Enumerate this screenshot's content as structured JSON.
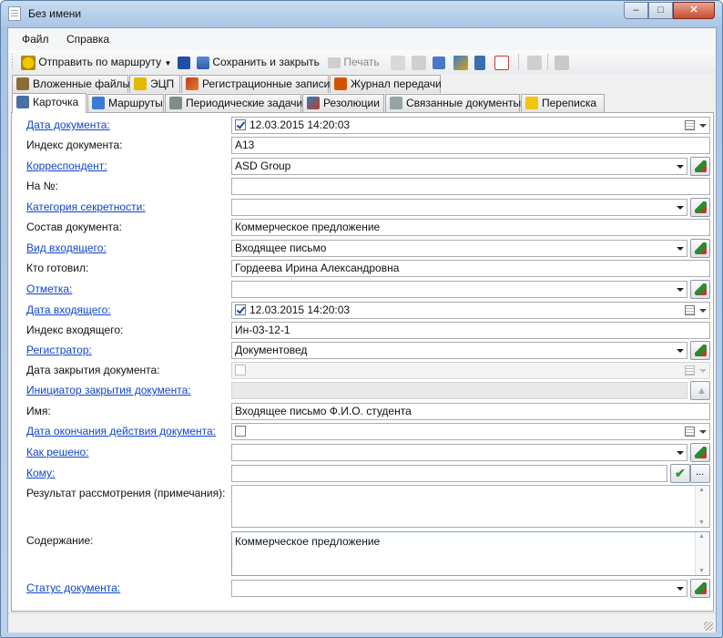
{
  "window": {
    "title": "Без имени",
    "min": "–",
    "max": "□",
    "close": "✕"
  },
  "menu": [
    {
      "label": "Файл"
    },
    {
      "label": "Справка"
    }
  ],
  "toolbar": {
    "route": "Отправить по маршруту",
    "save_close": "Сохранить и закрыть",
    "print": "Печать"
  },
  "tabs_row1": [
    {
      "label": "Вложенные файлы"
    },
    {
      "label": "ЭЦП"
    },
    {
      "label": "Регистрационные записи"
    },
    {
      "label": "Журнал передачи"
    }
  ],
  "tabs_row2": [
    {
      "label": "Карточка"
    },
    {
      "label": "Маршруты"
    },
    {
      "label": "Периодические задачи"
    },
    {
      "label": "Резолюции"
    },
    {
      "label": "Связанные документы"
    },
    {
      "label": "Переписка"
    }
  ],
  "fields": [
    {
      "label": "Дата документа:",
      "value": "12.03.2015 14:20:03",
      "checked": true
    },
    {
      "label": "Индекс документа:",
      "value": "А13"
    },
    {
      "label": "Корреспондент:",
      "value": "ASD Group"
    },
    {
      "label": "На №:",
      "value": ""
    },
    {
      "label": "Категория секретности:",
      "value": ""
    },
    {
      "label": "Состав документа:",
      "value": "Коммерческое предложение"
    },
    {
      "label": "Вид входящего:",
      "value": "Входящее письмо"
    },
    {
      "label": "Кто готовил:",
      "value": "Гордеева Ирина Александровна"
    },
    {
      "label": "Отметка:",
      "value": ""
    },
    {
      "label": "Дата входящего:",
      "value": "12.03.2015 14:20:03",
      "checked": true
    },
    {
      "label": "Индекс входящего:",
      "value": "Ин-03-12-1"
    },
    {
      "label": "Регистратор:",
      "value": "Документовед"
    },
    {
      "label": "Дата закрытия документа:",
      "value": "",
      "checked": false
    },
    {
      "label": "Инициатор закрытия документа:",
      "value": ""
    },
    {
      "label": "Имя:",
      "value": "Входящее письмо Ф.И.О. студента"
    },
    {
      "label": "Дата окончания действия документа:",
      "value": "",
      "checked": false
    },
    {
      "label": "Как решено:",
      "value": ""
    },
    {
      "label": "Кому:",
      "value": "",
      "ellipsis": "..."
    },
    {
      "label": "Результат рассмотрения (примечания):",
      "value": ""
    },
    {
      "label": "Содержание:",
      "value": "Коммерческое предложение"
    },
    {
      "label": "Статус документа:",
      "value": ""
    }
  ]
}
